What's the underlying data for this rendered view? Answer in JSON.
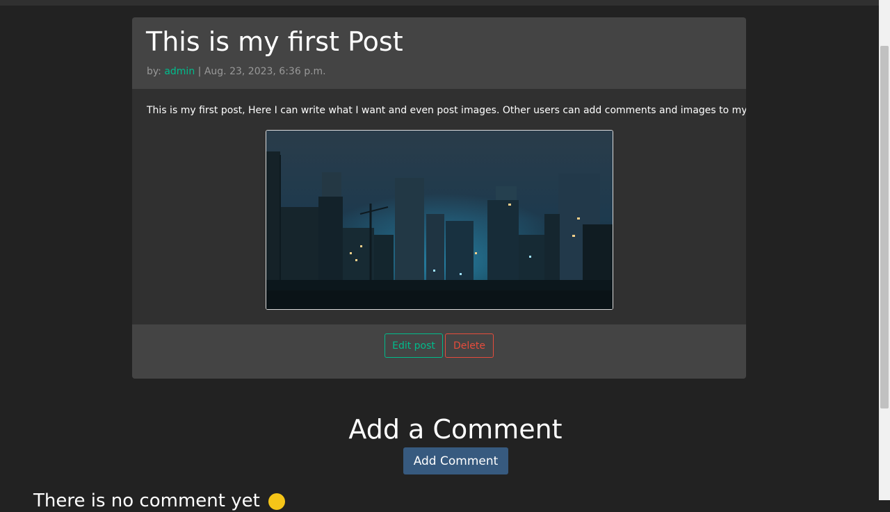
{
  "post": {
    "title": "This is my first Post",
    "by_label": "by:",
    "author": "admin",
    "separator": "|",
    "date": "Aug. 23, 2023, 6:36 p.m.",
    "body": "This is my first post, Here I can write what I want and even post images. Other users can add comments and images to my post.",
    "image_label": "post-image"
  },
  "actions": {
    "edit_label": "Edit post",
    "delete_label": "Delete"
  },
  "comments": {
    "heading": "Add a Comment",
    "add_button_label": "Add Comment",
    "next_text": "There is no comment yet"
  },
  "colors": {
    "background": "#222222",
    "card": "#303030",
    "card_header": "#444444",
    "accent_green": "#00bc8c",
    "danger_red": "#e74c3c",
    "primary_blue": "#375a7f"
  },
  "icons": {
    "emoji": "smiley-face-icon"
  }
}
